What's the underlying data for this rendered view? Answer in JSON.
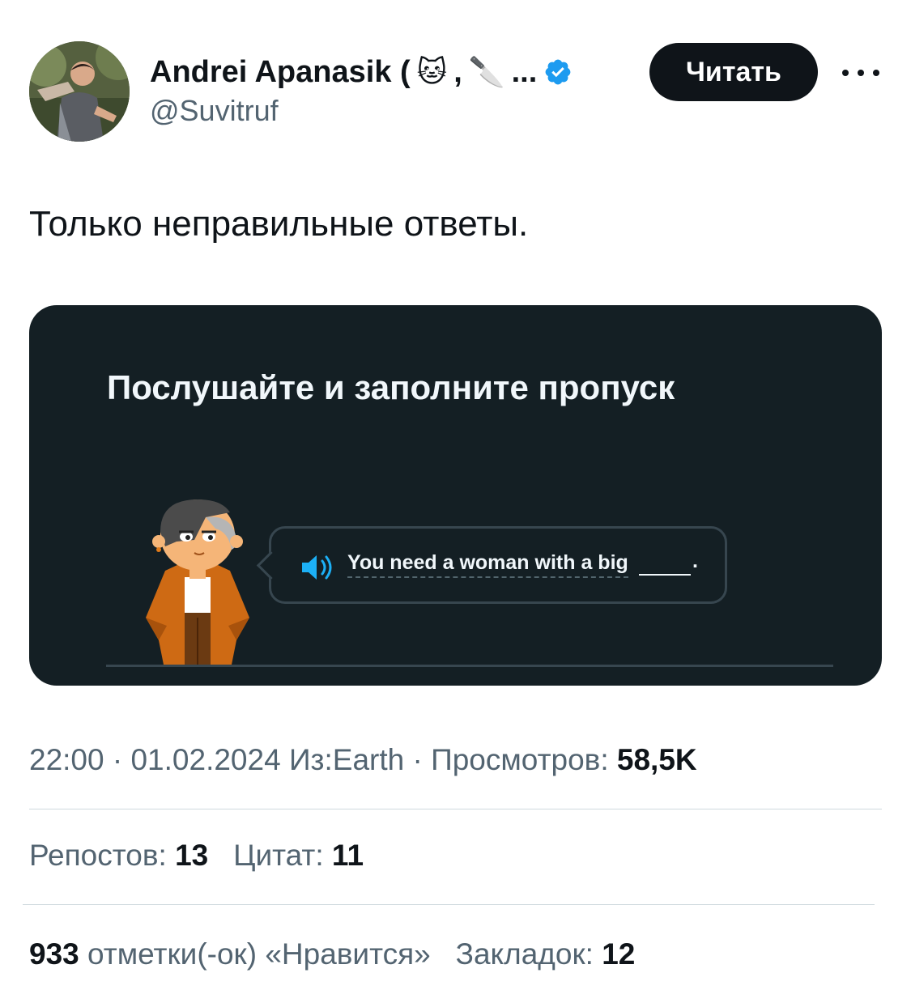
{
  "author": {
    "name": "Andrei Apanasik (",
    "emoji_cat": "🐱",
    "comma": ",",
    "emoji_knife": "🔪",
    "ellipsis": "...",
    "handle": "@Suvitruf"
  },
  "follow_label": "Читать",
  "tweet_text": "Только неправильные ответы.",
  "media": {
    "title": "Послушайте и заполните пропуск",
    "sentence": "You need a woman with a big",
    "period": "."
  },
  "meta": {
    "time": "22:00",
    "sep1": "·",
    "date": "01.02.2024",
    "source": "Из:Earth",
    "sep2": "·",
    "views_label": "Просмотров:",
    "views": "58,5K"
  },
  "stats": {
    "reposts_label": "Репостов:",
    "reposts": "13",
    "quotes_label": "Цитат:",
    "quotes": "11",
    "likes": "933",
    "likes_label": "отметки(-ок) «Нравится»",
    "bookmarks_label": "Закладок:",
    "bookmarks": "12"
  },
  "colors": {
    "verified": "#1d9bf0",
    "media_bg": "#141f24",
    "speaker": "#1cb0f6",
    "jacket": "#ce6a14"
  },
  "icons": [
    "verified-badge-icon",
    "more-icon",
    "speaker-icon"
  ]
}
